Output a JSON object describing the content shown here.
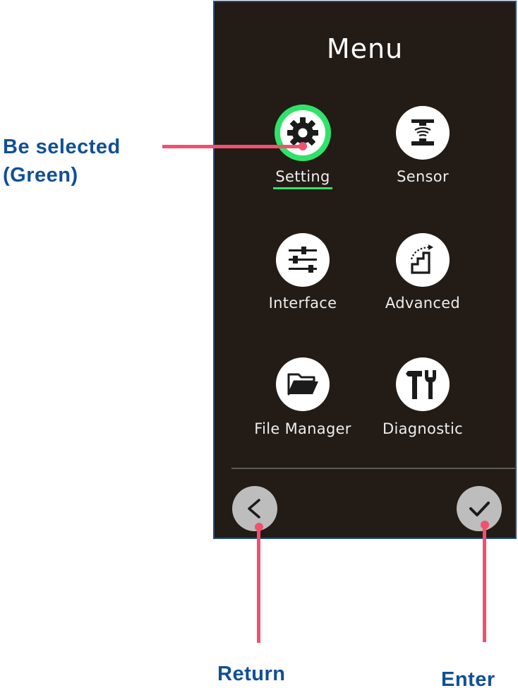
{
  "screen": {
    "title": "Menu",
    "items": [
      {
        "label": "Setting",
        "icon": "gear-icon",
        "selected": true
      },
      {
        "label": "Sensor",
        "icon": "sensor-icon",
        "selected": false
      },
      {
        "label": "Interface",
        "icon": "sliders-icon",
        "selected": false
      },
      {
        "label": "Advanced",
        "icon": "stairs-icon",
        "selected": false
      },
      {
        "label": "File Manager",
        "icon": "folder-icon",
        "selected": false
      },
      {
        "label": "Diagnostic",
        "icon": "tools-icon",
        "selected": false
      }
    ],
    "back_button_icon": "chevron-left-icon",
    "enter_button_icon": "checkmark-icon"
  },
  "annotations": {
    "selected_line1": "Be selected",
    "selected_line2": "(Green)",
    "return_label": "Return",
    "enter_label": "Enter"
  },
  "colors": {
    "screen_background": "#221b16",
    "selected_highlight": "#2fe36a",
    "annotation_text": "#114f97",
    "pointer_line": "#f2506e",
    "nav_button": "#bdbdbd"
  }
}
